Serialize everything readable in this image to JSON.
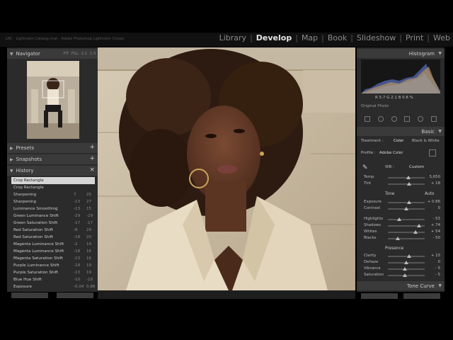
{
  "catalog_title": "LRC - Lightroom Catalog.lrcat - Adobe Photoshop Lightroom Classic",
  "modules": [
    "Library",
    "Develop",
    "Map",
    "Book",
    "Slideshow",
    "Print",
    "Web"
  ],
  "active_module": "Develop",
  "left_panel": {
    "navigator_label": "Navigator",
    "navigator_options": [
      "FIT",
      "FILL",
      "1:1",
      "1:3"
    ],
    "presets_label": "Presets",
    "snapshots_label": "Snapshots",
    "history_label": "History",
    "history": [
      {
        "name": "Crop Rectangle",
        "a": "",
        "b": "",
        "selected": true
      },
      {
        "name": "Crop Rectangle",
        "a": "",
        "b": ""
      },
      {
        "name": "Sharpening",
        "a": "7",
        "b": "25"
      },
      {
        "name": "Sharpening",
        "a": "-13",
        "b": "27"
      },
      {
        "name": "Luminance Smoothing",
        "a": "-13",
        "b": "15"
      },
      {
        "name": "Green Luminance Shift",
        "a": "-29",
        "b": "-29"
      },
      {
        "name": "Green Saturation Shift",
        "a": "-17",
        "b": "-17"
      },
      {
        "name": "Red Saturation Shift",
        "a": "-8",
        "b": "29"
      },
      {
        "name": "Red Saturation Shift",
        "a": "-18",
        "b": "20"
      },
      {
        "name": "Magenta Luminance Shift",
        "a": "-2",
        "b": "14"
      },
      {
        "name": "Magenta Luminance Shift",
        "a": "-18",
        "b": "16"
      },
      {
        "name": "Magenta Saturation Shift",
        "a": "-13",
        "b": "16"
      },
      {
        "name": "Purple Luminance Shift",
        "a": "-18",
        "b": "19"
      },
      {
        "name": "Purple Saturation Shift",
        "a": "-13",
        "b": "19"
      },
      {
        "name": "Blue Hue Shift",
        "a": "-10",
        "b": "-10"
      },
      {
        "name": "Exposure",
        "a": "-0.04",
        "b": "0.86"
      }
    ]
  },
  "right_panel": {
    "histogram_label": "Histogram",
    "rgb_readout": "R  5.7  G  2.1  B  0.8 %",
    "original_photo_label": "Original Photo",
    "basic_label": "Basic",
    "treatment_label": "Treatment :",
    "treatment_color": "Color",
    "treatment_bw": "Black & White",
    "profile_label": "Profile :",
    "profile_value": "Adobe Color",
    "wb_label": "WB :",
    "wb_value": "Custom",
    "tone_label": "Tone",
    "tone_auto": "Auto",
    "presence_label": "Presence",
    "tone_curve_label": "Tone Curve",
    "sliders_wb": [
      {
        "name": "Temp",
        "value": "5,650",
        "pos": 0.55
      },
      {
        "name": "Tint",
        "value": "+ 18",
        "pos": 0.58
      }
    ],
    "sliders_tone": [
      {
        "name": "Exposure",
        "value": "+ 0.86",
        "pos": 0.58
      },
      {
        "name": "Contrast",
        "value": "0",
        "pos": 0.5
      }
    ],
    "sliders_tone2": [
      {
        "name": "Highlights",
        "value": "- 53",
        "pos": 0.3
      },
      {
        "name": "Shadows",
        "value": "+ 74",
        "pos": 0.85
      },
      {
        "name": "Whites",
        "value": "+ 54",
        "pos": 0.75
      },
      {
        "name": "Blacks",
        "value": "- 50",
        "pos": 0.27
      }
    ],
    "sliders_presence": [
      {
        "name": "Clarity",
        "value": "+ 15",
        "pos": 0.58
      },
      {
        "name": "Dehaze",
        "value": "0",
        "pos": 0.5
      },
      {
        "name": "Vibrance",
        "value": "- 5",
        "pos": 0.46
      },
      {
        "name": "Saturation",
        "value": "- 5",
        "pos": 0.46
      }
    ]
  }
}
